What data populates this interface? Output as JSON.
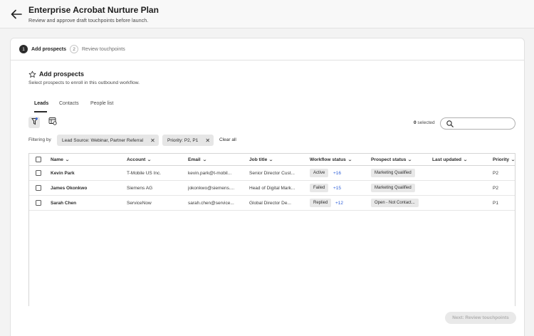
{
  "header": {
    "title": "Enterprise Acrobat Nurture Plan",
    "subtitle": "Review and approve draft touchpoints before launch."
  },
  "steps": [
    {
      "num": "1",
      "label": "Add prospects",
      "active": true
    },
    {
      "num": "2",
      "label": "Review touchpoints",
      "active": false
    }
  ],
  "section": {
    "title": "Add prospects",
    "description": "Select prospects to enroll in this outbound workflow."
  },
  "tabs": [
    {
      "label": "Leads",
      "active": true
    },
    {
      "label": "Contacts",
      "active": false
    },
    {
      "label": "People list",
      "active": false
    }
  ],
  "toolbar": {
    "selected_count": "0",
    "selected_suffix": " selected",
    "search_placeholder": ""
  },
  "filters": {
    "label": "Filtering by",
    "chips": [
      {
        "label": "Lead Source: Webinar, Partner Referral"
      },
      {
        "label": "Priority: P2, P1"
      }
    ],
    "clear_label": "Clear all"
  },
  "table": {
    "columns": [
      "Name",
      "Account",
      "Email",
      "Job title",
      "Workflow status",
      "Prospect status",
      "Last updated",
      "Priority"
    ],
    "rows": [
      {
        "name": "Kevin Park",
        "account": "T-Mobile US Inc.",
        "email": "kevin.park@t-mobil...",
        "job_title": "Senior Director Cust...",
        "workflow_status": "Active",
        "workflow_more": "+16",
        "prospect_status": "Marketing Qualified",
        "last_updated": "",
        "priority": "P2"
      },
      {
        "name": "James Okonkwo",
        "account": "Siemens AG",
        "email": "jokonkwo@siemens....",
        "job_title": "Head of Digital Mark...",
        "workflow_status": "Failed",
        "workflow_more": "+15",
        "prospect_status": "Marketing Qualified",
        "last_updated": "",
        "priority": "P2"
      },
      {
        "name": "Sarah Chen",
        "account": "ServiceNow",
        "email": "sarah.chen@service...",
        "job_title": "Global Director De...",
        "workflow_status": "Replied",
        "workflow_more": "+12",
        "prospect_status": "Open - Not Contact...",
        "last_updated": "",
        "priority": "P1"
      }
    ]
  },
  "footer": {
    "next_label": "Next: Review touchpoints"
  }
}
